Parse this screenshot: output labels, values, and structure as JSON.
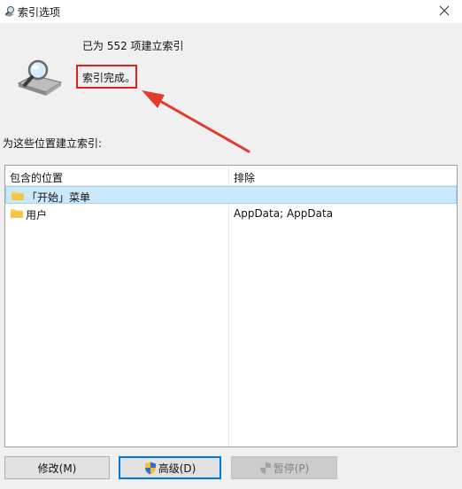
{
  "window": {
    "title": "索引选项"
  },
  "status": {
    "count_text": "已为 552 项建立索引",
    "message": "索引完成。"
  },
  "locations_label": "为这些位置建立索引:",
  "table": {
    "columns": [
      "包含的位置",
      "排除"
    ],
    "rows": [
      {
        "location": "「开始」菜单",
        "excluded": "",
        "selected": true
      },
      {
        "location": "用户",
        "excluded": "AppData; AppData",
        "selected": false
      }
    ]
  },
  "buttons": {
    "modify": "修改(M)",
    "advanced": "高级(D)",
    "pause": "暂停(P)"
  },
  "colors": {
    "highlight_border": "#e02020",
    "arrow": "#e33b2f",
    "selection": "#cce8ff",
    "default_button_border": "#0078d7"
  },
  "icons": [
    "indexing-options-icon",
    "close-icon",
    "indexer-magnifier-icon",
    "folder-icon",
    "uac-shield-icon"
  ]
}
